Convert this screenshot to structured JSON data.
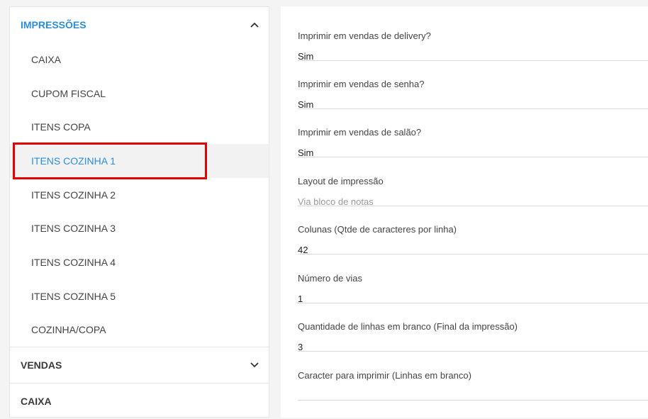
{
  "sidebar": {
    "impressoes": {
      "title": "IMPRESSÕES",
      "items": [
        {
          "label": "CAIXA"
        },
        {
          "label": "CUPOM FISCAL"
        },
        {
          "label": "ITENS COPA"
        },
        {
          "label": "ITENS COZINHA 1"
        },
        {
          "label": "ITENS COZINHA 2"
        },
        {
          "label": "ITENS COZINHA 3"
        },
        {
          "label": "ITENS COZINHA 4"
        },
        {
          "label": "ITENS COZINHA 5"
        },
        {
          "label": "COZINHA/COPA"
        }
      ],
      "selected_item": "ITENS COZINHA 1"
    },
    "vendas": {
      "title": "VENDAS"
    },
    "caixa": {
      "title": "CAIXA"
    }
  },
  "form": {
    "fields": [
      {
        "label": "Imprimir em vendas de delivery?",
        "value": "Sim"
      },
      {
        "label": "Imprimir em vendas de senha?",
        "value": "Sim"
      },
      {
        "label": "Imprimir em vendas de salão?",
        "value": "Sim"
      },
      {
        "label": "Layout de impressão",
        "placeholder": "Via bloco de notas"
      },
      {
        "label": "Colunas (Qtde de caracteres por linha)",
        "value": "42"
      },
      {
        "label": "Número de vias",
        "value": "1"
      },
      {
        "label": "Quantidade de linhas em branco (Final da impressão)",
        "value": "3"
      },
      {
        "label": "Caracter para imprimir (Linhas em branco)",
        "value": ""
      }
    ]
  },
  "colors": {
    "accent": "#2c8ed6",
    "highlight": "#e00000"
  },
  "icons": {
    "impressoes_toggle": "chevron-up-icon",
    "vendas_toggle": "chevron-down-icon"
  }
}
